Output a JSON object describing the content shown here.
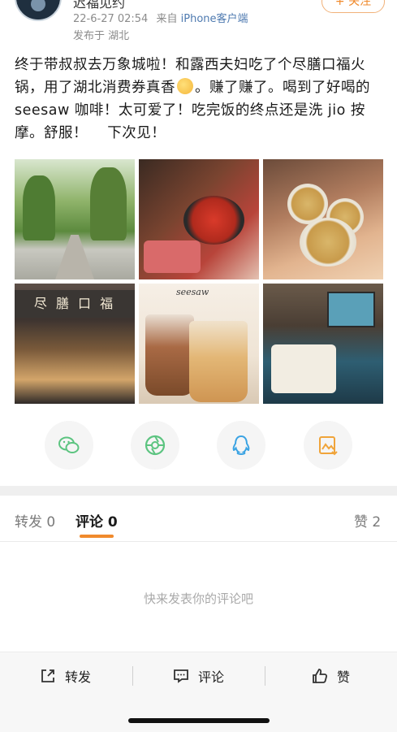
{
  "user": {
    "name": "迟福见约",
    "follow_label": "+ 关注",
    "meta_date": "22-6-27 02:54",
    "meta_from_prefix": "来自",
    "meta_source": "iPhone客户端",
    "location": "发布于 湖北"
  },
  "post": {
    "text_part1": "终于带叔叔去万象城啦！和露西夫妇吃了个尽膳口福火锅，用了湖北消费券真香",
    "text_part2": "。赚了赚了。喝到了好喝的 seesaw 咖啡！太可爱了！吃完饭的终点还是洗 jio 按摩。舒服！    下次见！",
    "photos": [
      {
        "name": "park-path-photo"
      },
      {
        "name": "hotpot-photo"
      },
      {
        "name": "tea-cheers-photo"
      },
      {
        "name": "restaurant-front-photo",
        "sign": "尽 膳 口 福"
      },
      {
        "name": "seesaw-coffee-photo",
        "brand": "seesaw"
      },
      {
        "name": "massage-room-photo"
      }
    ]
  },
  "share": [
    {
      "icon": "wechat-icon",
      "color": "#5cc480"
    },
    {
      "icon": "moments-icon",
      "color": "#5cc480"
    },
    {
      "icon": "qq-icon",
      "color": "#3aa3e3"
    },
    {
      "icon": "save-image-icon",
      "color": "#f0a43a"
    }
  ],
  "tabs": {
    "repost": "转发 0",
    "comment": "评论 0",
    "like": "赞 2"
  },
  "comments": {
    "empty_hint": "快来发表你的评论吧"
  },
  "bottom_bar": {
    "repost": "转发",
    "comment": "评论",
    "like": "赞"
  },
  "colors": {
    "accent": "#f08a2c",
    "link": "#4e7ab0"
  }
}
